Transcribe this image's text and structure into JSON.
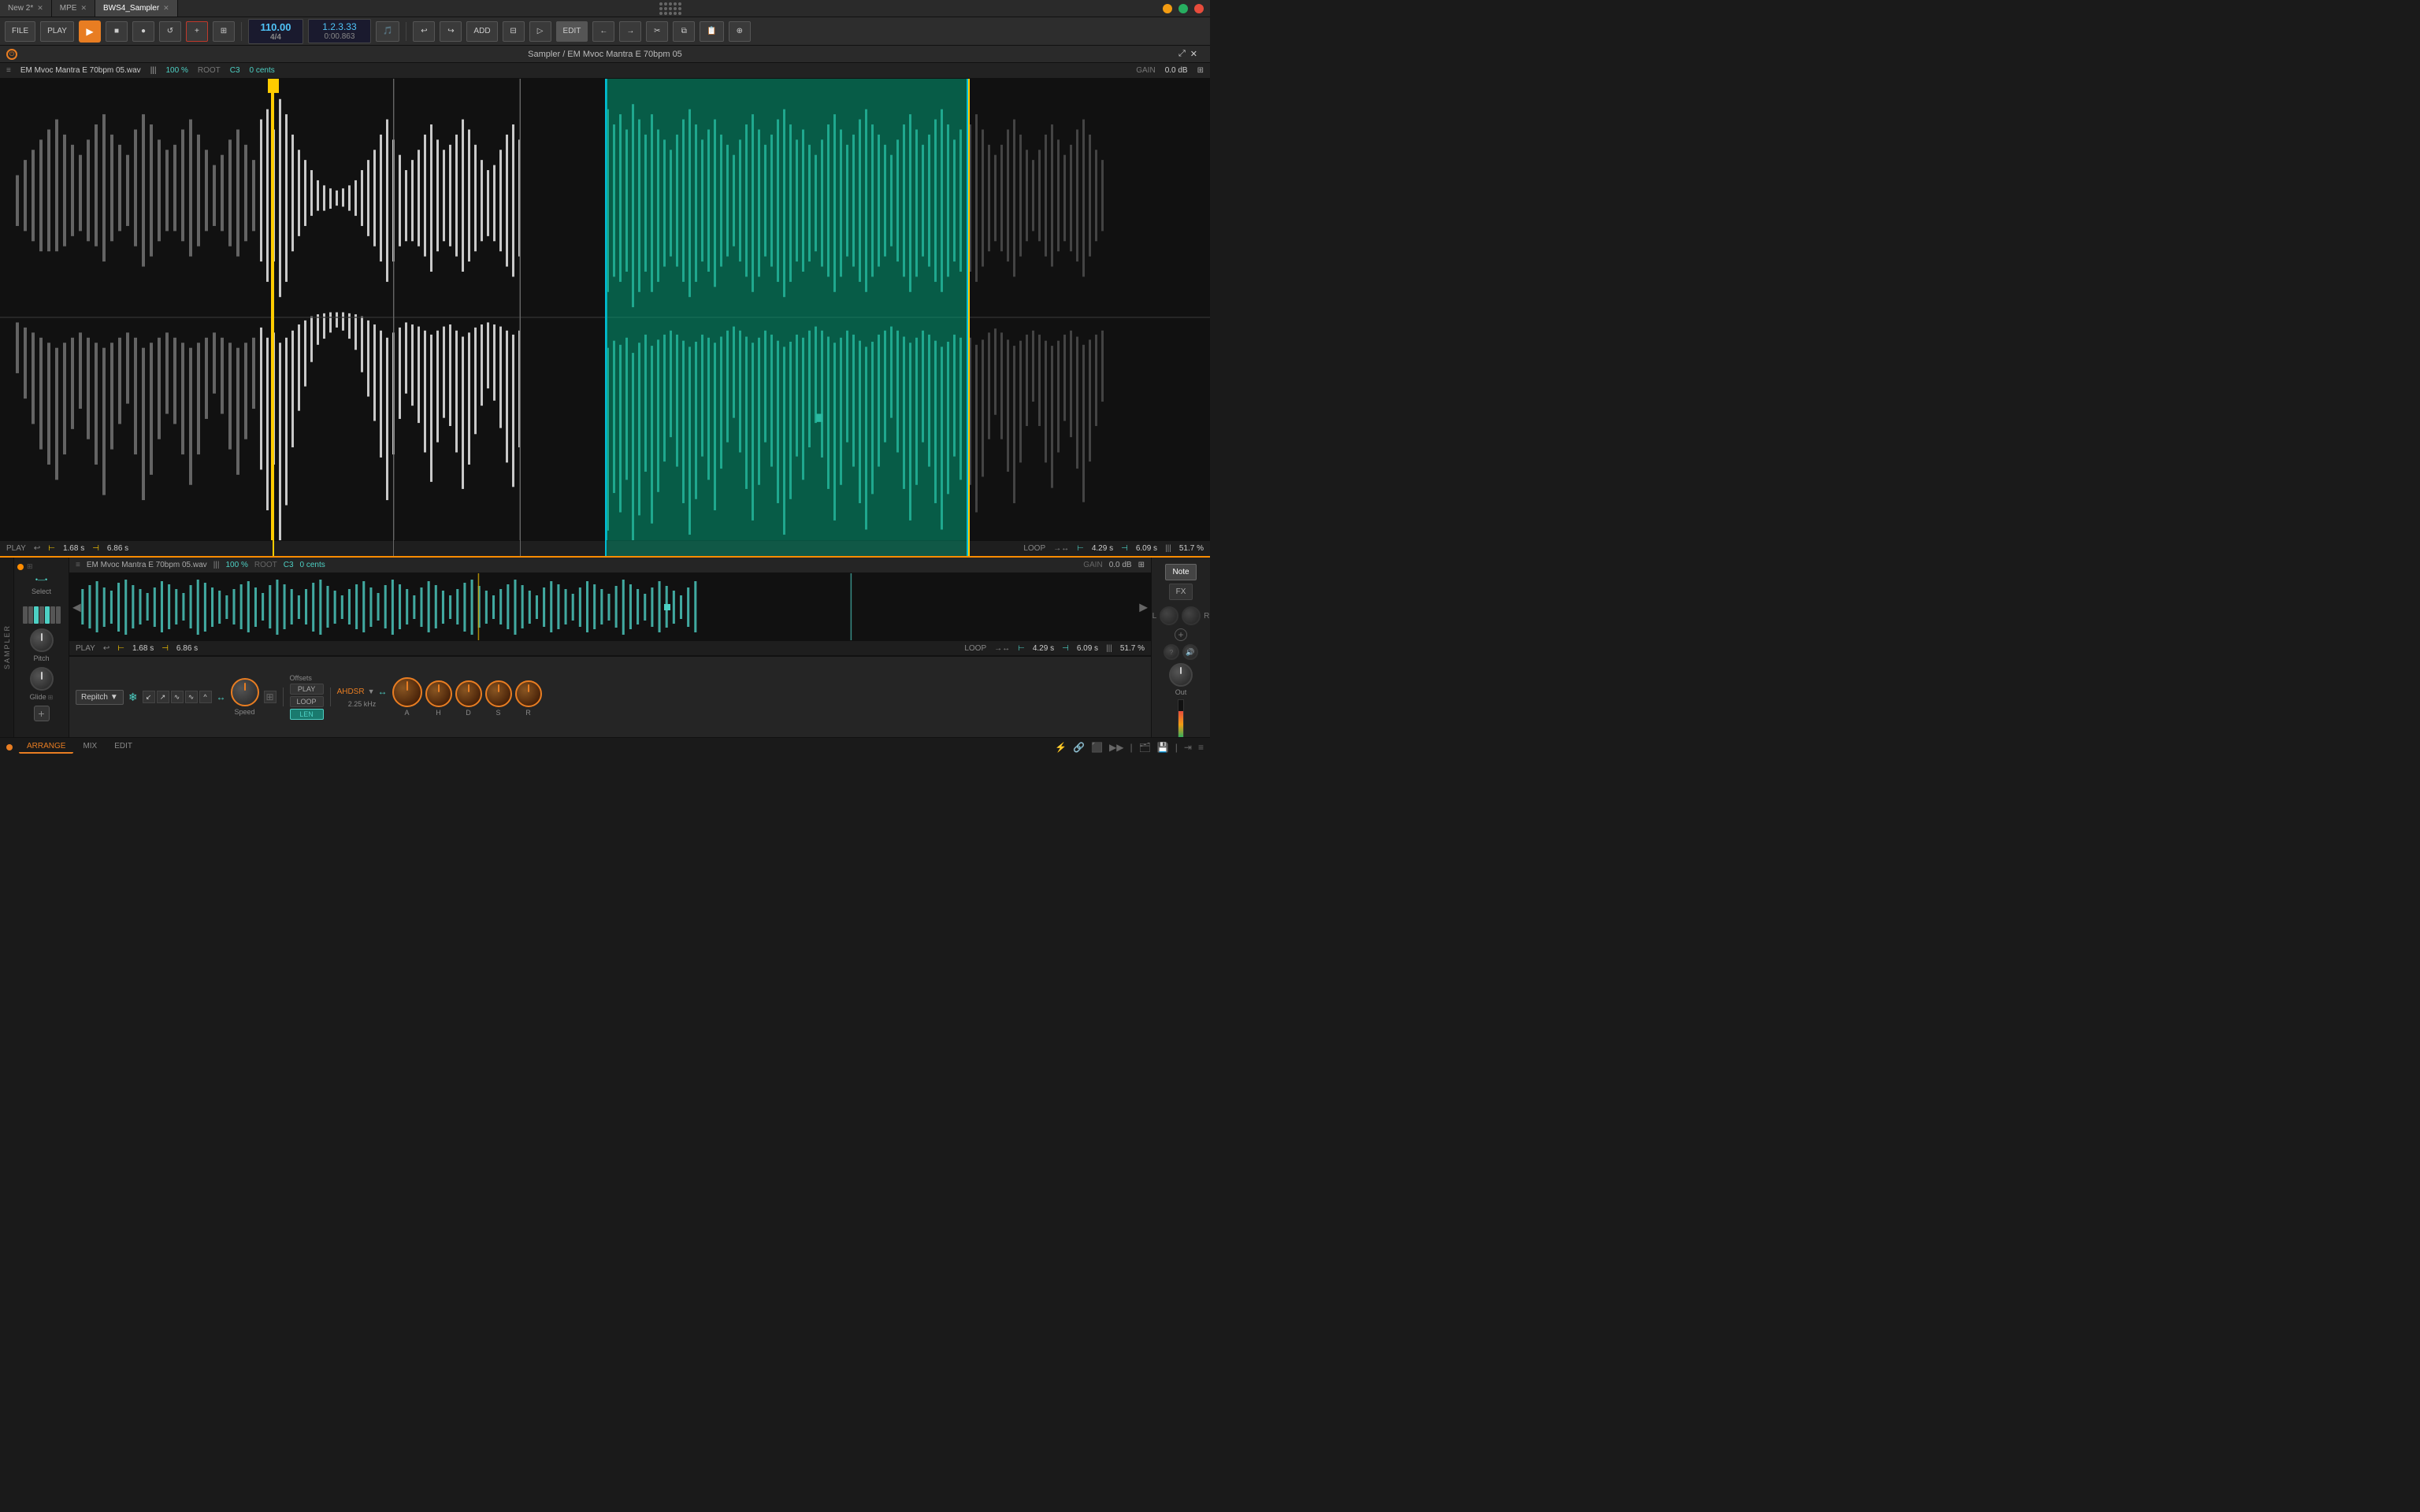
{
  "tabs": [
    {
      "label": "New 2*",
      "active": false,
      "closeable": true
    },
    {
      "label": "MPE",
      "active": false,
      "closeable": true
    },
    {
      "label": "BWS4_Sampler",
      "active": true,
      "closeable": true
    }
  ],
  "toolbar": {
    "file_label": "FILE",
    "play_label": "PLAY",
    "add_label": "ADD",
    "edit_label": "EDIT",
    "tempo": "110.00",
    "time_sig": "4/4",
    "position_bar": "1.2.3.33",
    "position_time": "0:00.863"
  },
  "sampler": {
    "title": "Sampler / EM Mvoc Mantra E 70bpm 05",
    "filename": "EM Mvoc Mantra E 70bpm 05.wav",
    "zoom": "100 %",
    "root": "C3",
    "cents": "0 cents",
    "gain": "0.0 dB",
    "play_label": "PLAY",
    "start_marker": "1.68 s",
    "end_marker": "6.86 s",
    "loop_label": "LOOP",
    "loop_start": "4.29 s",
    "loop_end": "6.09 s",
    "loop_percent": "51.7 %"
  },
  "bottom_panel": {
    "note_btn": "Note",
    "fx_btn": "FX",
    "select_label": "Select",
    "pitch_label": "Pitch",
    "glide_label": "Glide",
    "repitch_label": "Repitch",
    "speed_label": "Speed",
    "offsets_label": "Offsets",
    "play_btn": "PLAY",
    "loop_btn": "LOOP",
    "len_btn": "LEN",
    "ahdsr_label": "AHDSR",
    "freq_label": "2.25 kHz",
    "env_labels": [
      "A",
      "H",
      "D",
      "S",
      "R"
    ],
    "out_label": "Out",
    "l_label": "L",
    "r_label": "R"
  },
  "bottom_bar": {
    "arrange_label": "ARRANGE",
    "mix_label": "MIX",
    "edit_label": "EDIT"
  },
  "colors": {
    "accent_orange": "#e87d22",
    "accent_teal": "#4dd0c4",
    "accent_cyan": "#4fc3f7",
    "bg_dark": "#1a1a1a",
    "bg_mid": "#252525",
    "marker_yellow": "#ffcc00"
  }
}
